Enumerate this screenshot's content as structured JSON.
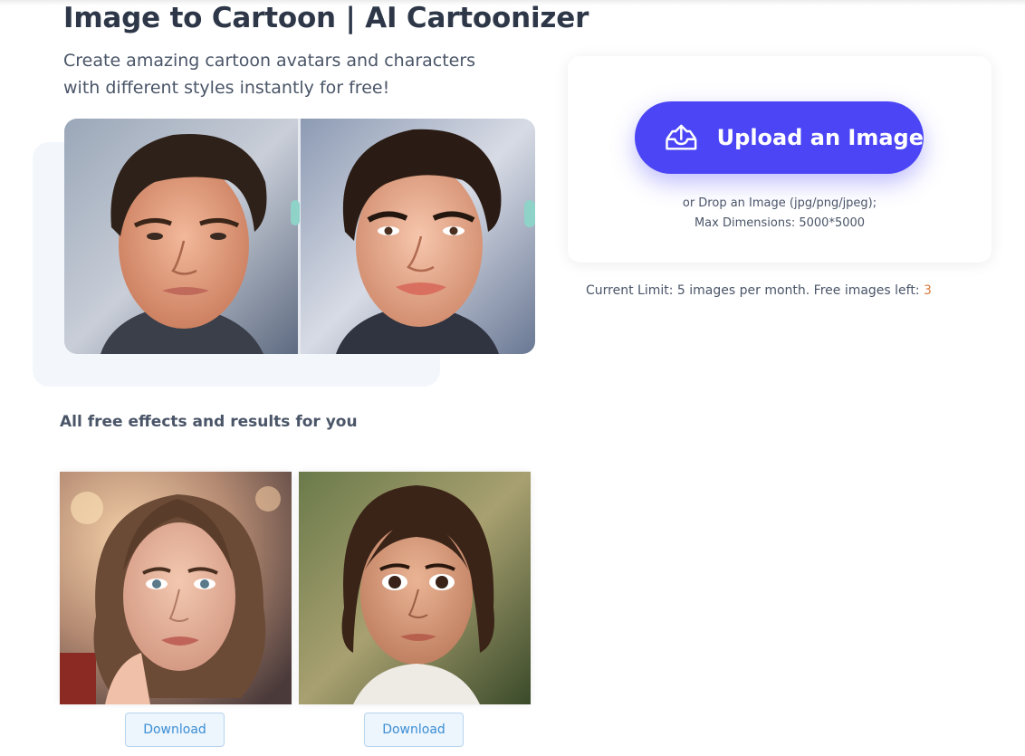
{
  "header": {
    "title": "Image to Cartoon | AI Cartoonizer",
    "subtitle": "Create amazing cartoon avatars and characters with different styles instantly for free!"
  },
  "upload": {
    "button_label": "Upload an Image",
    "button_icon": "upload-tray-icon",
    "hint_line1": "or Drop an Image (jpg/png/jpeg);",
    "hint_line2": "Max Dimensions: 5000*5000"
  },
  "limit": {
    "text": "Current Limit: 5 images per month. Free images left: ",
    "images_left": "3"
  },
  "effects": {
    "title": "All free effects and results for you",
    "download_label": "Download"
  },
  "colors": {
    "accent": "#4b45f5",
    "images_left": "#d97a3a",
    "download_text": "#3b8fd4"
  }
}
